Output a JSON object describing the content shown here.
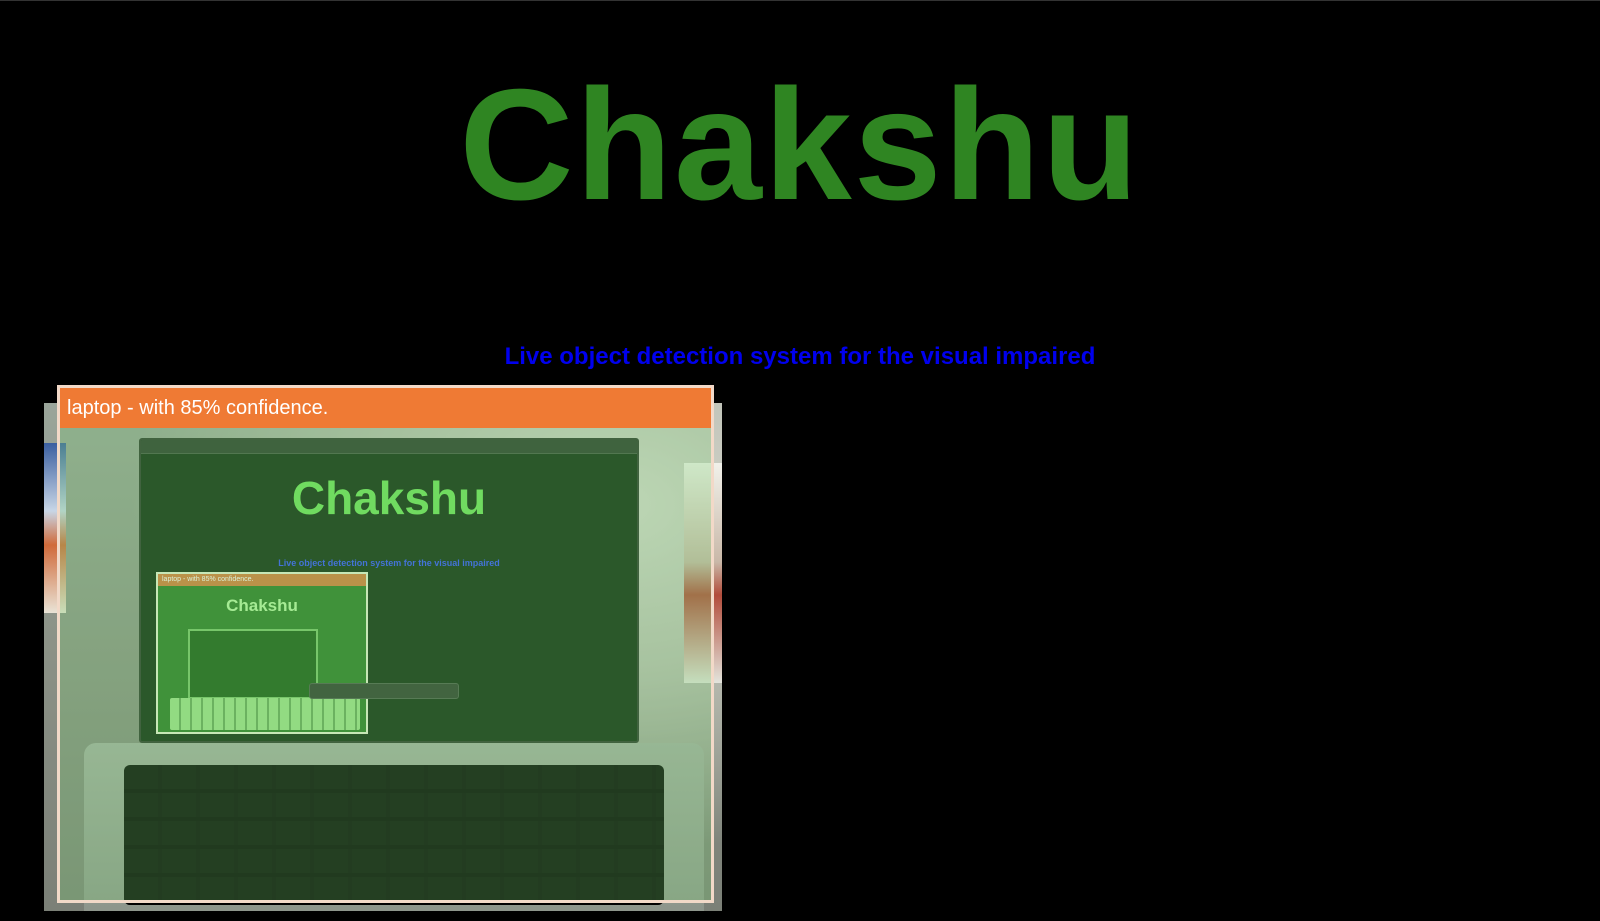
{
  "header": {
    "title": "Chakshu",
    "subtitle": "Live object detection system for the visual impaired"
  },
  "detection": {
    "label": "laptop - with 85% confidence.",
    "object": "laptop",
    "confidence_percent": 85
  },
  "camera_scene": {
    "screen_title": "Chakshu",
    "screen_subtitle": "Live object detection system for the visual impaired",
    "nested_label": "laptop - with 85% confidence.",
    "nested_title": "Chakshu"
  },
  "colors": {
    "title": "#2f8522",
    "subtitle": "#0000ee",
    "label_bg": "#ef7a34",
    "box_border": "#f2d9c8",
    "background": "#000000"
  }
}
